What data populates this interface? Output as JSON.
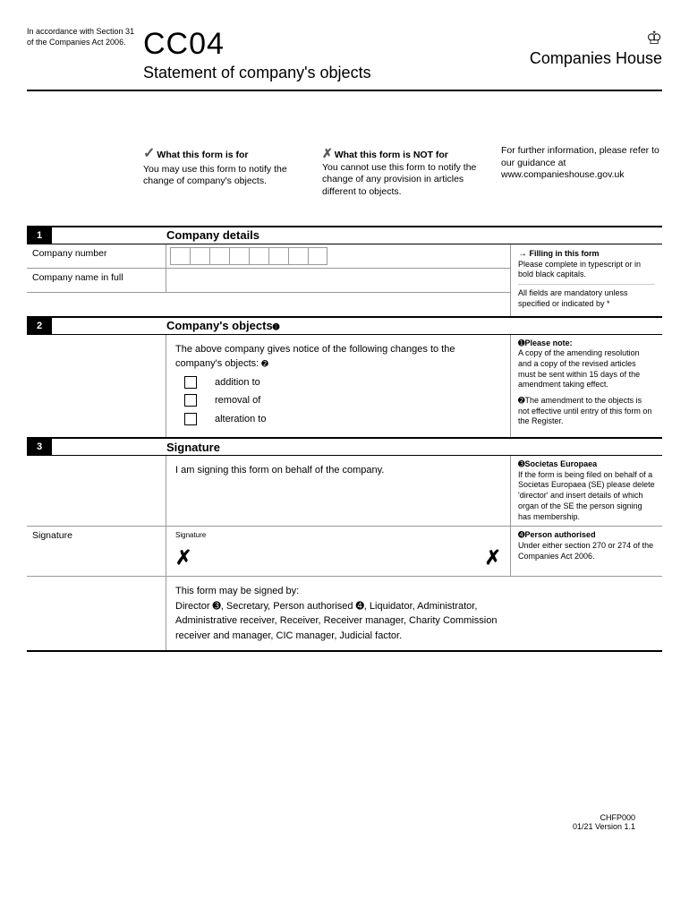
{
  "header": {
    "accordance": "In accordance with Section 31 of the Companies Act 2006.",
    "form_code": "CC04",
    "form_title": "Statement of company's objects",
    "agency": "Companies House"
  },
  "info": {
    "is_for_title": "What this form is for",
    "is_for_text": "You may use this form to notify the change of company's objects.",
    "not_for_title": "What this form is NOT for",
    "not_for_text": "You cannot use this form to notify the change of any provision in articles different to objects.",
    "further_text": "For further information, please refer to our guidance at",
    "further_url": "www.companieshouse.gov.uk"
  },
  "section1": {
    "num": "1",
    "title": "Company details",
    "label_number": "Company number",
    "label_name": "Company name in full",
    "side_title": "Filling in this form",
    "side_text1": "Please complete in typescript or in bold black capitals.",
    "side_text2": "All fields are mandatory unless specified or indicated by *"
  },
  "section2": {
    "num": "2",
    "title": "Company's objects",
    "intro": "The above company gives notice of the following changes to the company's objects:",
    "opt1": "addition to",
    "opt2": "removal of",
    "opt3": "alteration to",
    "note1_title": "Please note:",
    "note1_text": "A copy of the amending resolution and a copy of the revised articles must be sent within 15 days of the amendment taking effect.",
    "note2_text": "The amendment to the objects is not effective until entry of this form on the Register."
  },
  "section3": {
    "num": "3",
    "title": "Signature",
    "intro": "I am signing this form on behalf of the company.",
    "label_sig": "Signature",
    "sig_field_label": "Signature",
    "signed_by": "This form may be signed by:",
    "signed_by_list": "Director ➌, Secretary, Person authorised ➍, Liquidator, Administrator, Administrative receiver, Receiver, Receiver manager, Charity Commission receiver and manager, CIC manager, Judicial factor.",
    "note3_title": "Societas Europaea",
    "note3_text": "If the form is being filed on behalf of a Societas Europaea (SE) please delete 'director' and insert details of which organ of the SE the person signing has membership.",
    "note4_title": "Person authorised",
    "note4_text": "Under either section 270 or 274 of the Companies Act 2006."
  },
  "footer": {
    "code": "CHFP000",
    "version": "01/21 Version 1.1"
  }
}
